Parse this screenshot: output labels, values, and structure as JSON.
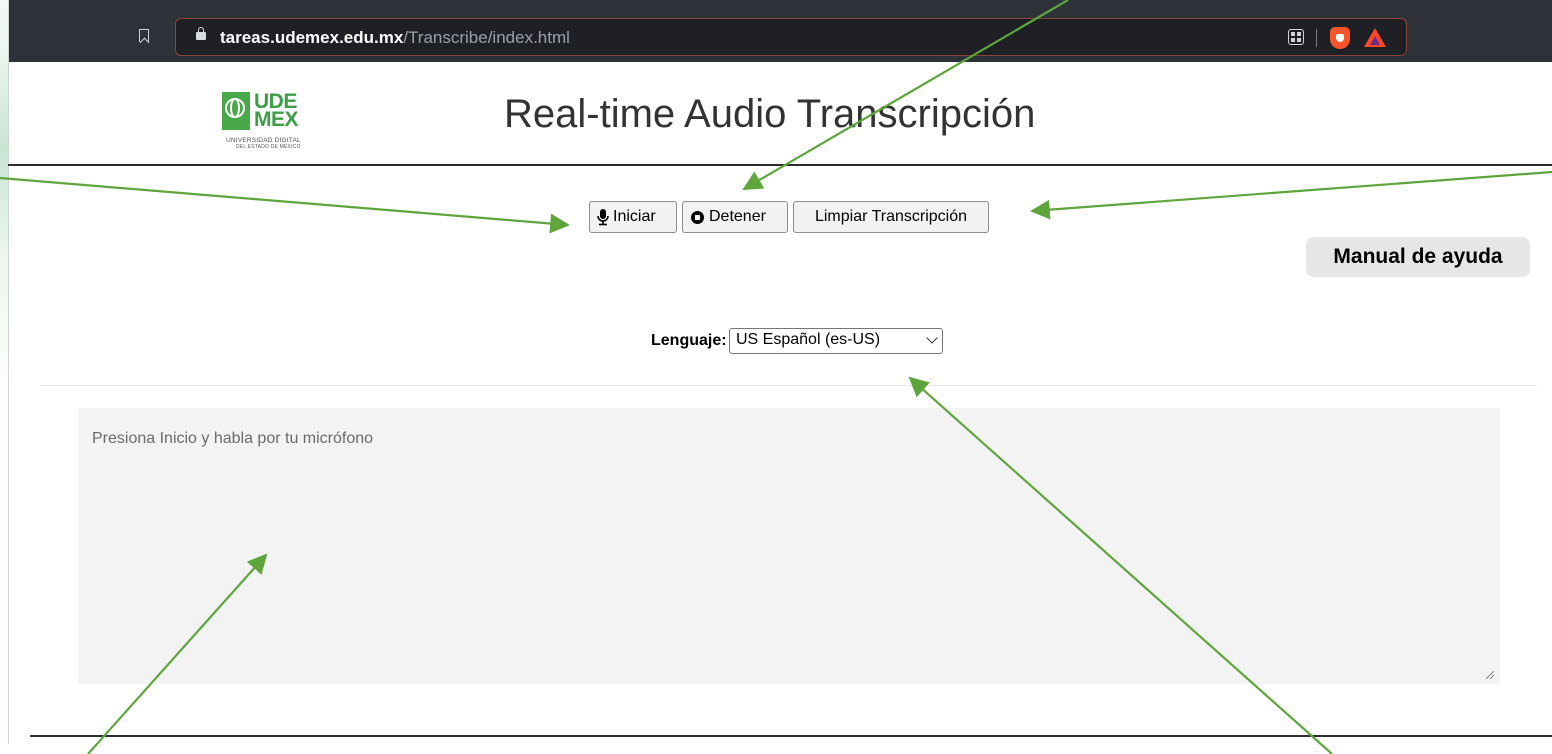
{
  "browser": {
    "url_domain": "tareas.udemex.edu.mx",
    "url_path": "/Transcribe/index.html"
  },
  "logo": {
    "line1": "UDE",
    "line2": "MEX",
    "sub1": "UNIVERSIDAD DIGITAL",
    "sub2": "DEL ESTADO DE MÉXICO"
  },
  "header": {
    "title": "Real-time Audio Transcripción"
  },
  "controls": {
    "start_label": "Iniciar",
    "stop_label": "Detener",
    "clear_label": "Limpiar Transcripción"
  },
  "help": {
    "label": "Manual de ayuda"
  },
  "language": {
    "label": "Lenguaje:",
    "selected": "US Español (es-US)"
  },
  "transcript": {
    "placeholder": "Presiona Inicio y habla por tu micrófono"
  },
  "annotations": {
    "arrow_color": "#5ea53c"
  }
}
